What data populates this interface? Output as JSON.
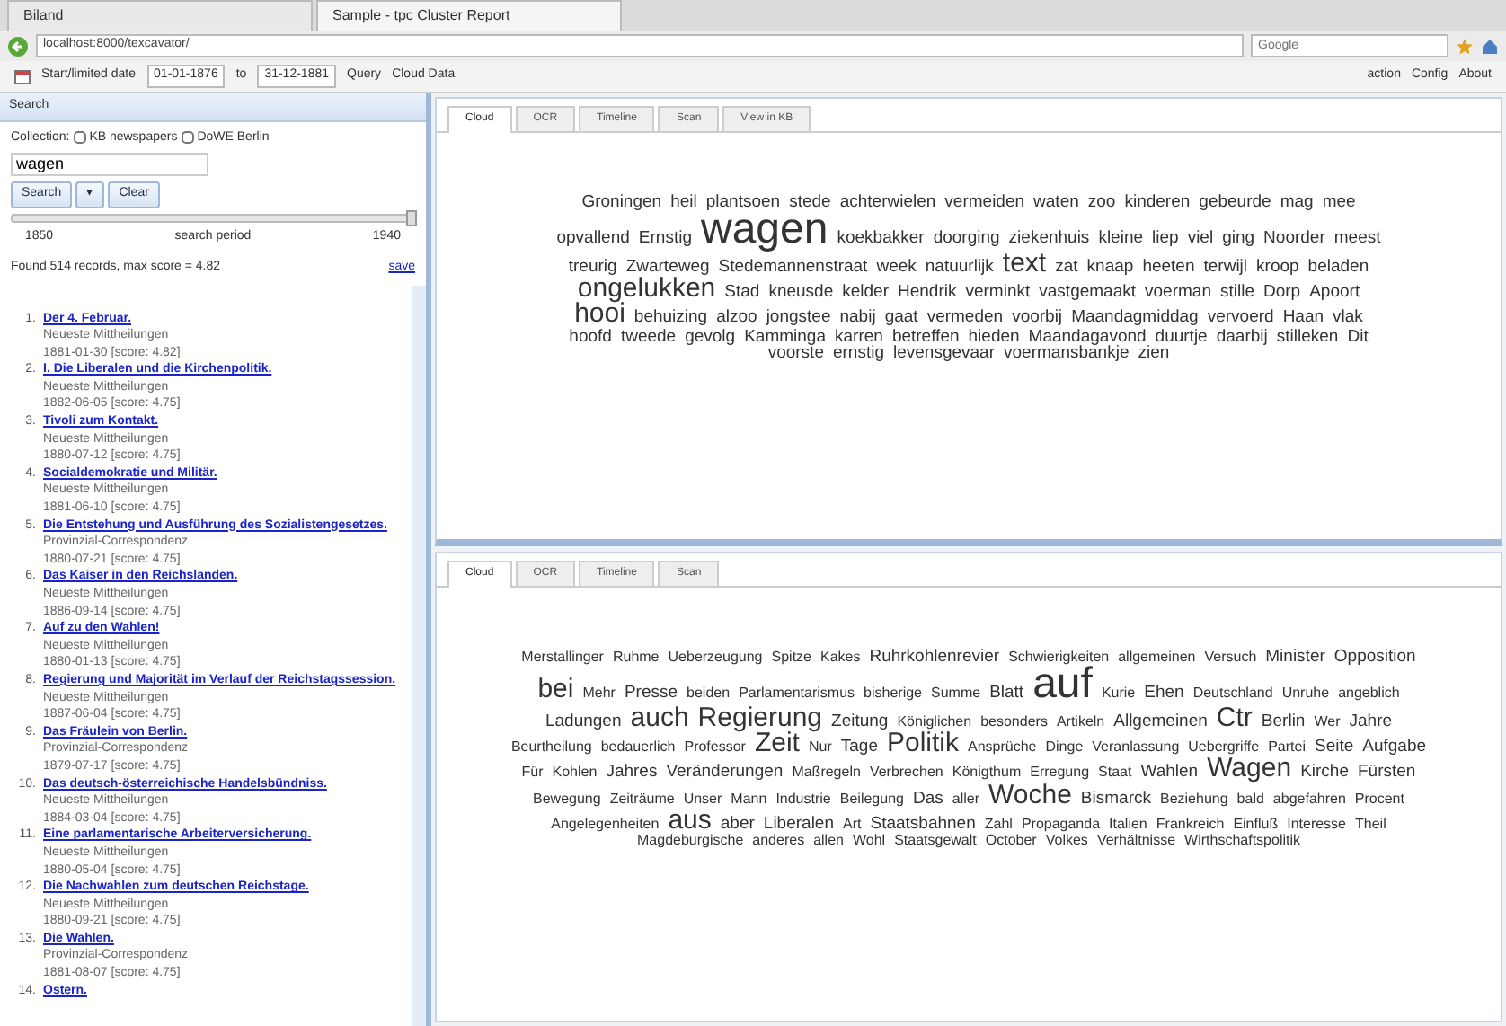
{
  "browser": {
    "tabs": [
      {
        "label": "Biland",
        "selected": false
      },
      {
        "label": "Sample - tpc Cluster Report",
        "selected": true
      }
    ],
    "address": "localhost:8000/texcavator/",
    "search_placeholder": "Google"
  },
  "toolbar": {
    "date_label": "Start/limited date",
    "start_date": "01-01-1876",
    "to": "to",
    "end_date": "31-12-1881",
    "buttons": [
      "Query",
      "Cloud Data"
    ],
    "right": [
      "action",
      "Config",
      "About"
    ]
  },
  "search": {
    "title": "Search",
    "collection_label": "Collection:",
    "collections": [
      {
        "label": "KB newspapers",
        "checked": false
      },
      {
        "label": "DoWE Berlin",
        "checked": false
      }
    ],
    "query": "wagen",
    "search_button": "Search",
    "dropdown_caret": "▾",
    "clear_button": "Clear",
    "range": {
      "level": 1
    },
    "range_start": "1850",
    "range_label": "search period",
    "range_end": "1940",
    "found": "Found 514 records, max score = 4.82",
    "save": "save"
  },
  "results": [
    {
      "number": "1.",
      "title": "Der 4. Februar.",
      "source": "Neueste Mittheilungen",
      "date": "1881-01-30 [score: 4.82]"
    },
    {
      "number": "2.",
      "title": "I. Die Liberalen und die Kirchenpolitik.",
      "source": "Neueste Mittheilungen",
      "date": "1882-06-05 [score: 4.75]"
    },
    {
      "number": "3.",
      "title": "Tivoli zum Kontakt.",
      "source": "Neueste Mittheilungen",
      "date": "1880-07-12 [score: 4.75]"
    },
    {
      "number": "4.",
      "title": "Socialdemokratie und Militär.",
      "source": "Neueste Mittheilungen",
      "date": "1881-06-10 [score: 4.75]"
    },
    {
      "number": "5.",
      "title": "Die Entstehung und Ausführung des Sozialistengesetzes.",
      "source": "Provinzial-Correspondenz",
      "date": "1880-07-21 [score: 4.75]"
    },
    {
      "number": "6.",
      "title": "Das Kaiser in den Reichslanden.",
      "source": "Neueste Mittheilungen",
      "date": "1886-09-14 [score: 4.75]"
    },
    {
      "number": "7.",
      "title": "Auf zu den Wahlen!",
      "source": "Neueste Mittheilungen",
      "date": "1880-01-13 [score: 4.75]"
    },
    {
      "number": "8.",
      "title": "Regierung und Majorität im Verlauf der Reichstagssession.",
      "source": "Neueste Mittheilungen",
      "date": "1887-06-04 [score: 4.75]"
    },
    {
      "number": "9.",
      "title": "Das Fräulein von Berlin.",
      "source": "Provinzial-Correspondenz",
      "date": "1879-07-17 [score: 4.75]"
    },
    {
      "number": "10.",
      "title": "Das deutsch-österreichische Handelsbündniss.",
      "source": "Neueste Mittheilungen",
      "date": "1884-03-04 [score: 4.75]"
    },
    {
      "number": "11.",
      "title": "Eine parlamentarische Arbeiterversicherung.",
      "source": "Neueste Mittheilungen",
      "date": "1880-05-04 [score: 4.75]"
    },
    {
      "number": "12.",
      "title": "Die Nachwahlen zum deutschen Reichstage.",
      "source": "Neueste Mittheilungen",
      "date": "1880-09-21 [score: 4.75]"
    },
    {
      "number": "13.",
      "title": "Die Wahlen.",
      "source": "Provinzial-Correspondenz",
      "date": "1881-08-07 [score: 4.75]"
    },
    {
      "number": "14.",
      "title": "Ostern."
    }
  ],
  "panels": [
    {
      "tabs": [
        {
          "label": "Cloud",
          "selected": true
        },
        {
          "label": "OCR",
          "selected": false
        },
        {
          "label": "Timeline",
          "selected": false
        },
        {
          "label": "Scan",
          "selected": false
        },
        {
          "label": "View in KB",
          "selected": false
        }
      ],
      "words": [
        {
          "text": "Groningen",
          "kind": "medium"
        },
        {
          "text": "heil",
          "kind": "medium"
        },
        {
          "text": "plantsoen",
          "kind": "medium"
        },
        {
          "text": "stede",
          "kind": "medium"
        },
        {
          "text": "achterwielen",
          "kind": "medium"
        },
        {
          "text": "vermeiden",
          "kind": "medium"
        },
        {
          "text": "waten",
          "kind": "medium"
        },
        {
          "text": "zoo",
          "kind": "medium"
        },
        {
          "text": "kinderen",
          "kind": "medium"
        },
        {
          "text": "gebeurde",
          "kind": "medium"
        },
        {
          "text": "mag",
          "kind": "medium"
        },
        {
          "text": "mee",
          "kind": "medium"
        },
        {
          "text": "opvallend",
          "kind": "medium"
        },
        {
          "text": "Ernstig",
          "kind": "medium"
        },
        {
          "text": "wagen",
          "kind": "huge"
        },
        {
          "text": "koekbakker",
          "kind": "medium"
        },
        {
          "text": "doorging",
          "kind": "medium"
        },
        {
          "text": "ziekenhuis",
          "kind": "medium"
        },
        {
          "text": "kleine",
          "kind": "medium"
        },
        {
          "text": "liep",
          "kind": "medium"
        },
        {
          "text": "viel",
          "kind": "medium"
        },
        {
          "text": "ging",
          "kind": "medium"
        },
        {
          "text": "Noorder",
          "kind": "medium"
        },
        {
          "text": "meest",
          "kind": "medium"
        },
        {
          "text": "treurig",
          "kind": "medium"
        },
        {
          "text": "Zwarteweg",
          "kind": "medium"
        },
        {
          "text": "Stedemannenstraat",
          "kind": "medium"
        },
        {
          "text": "week",
          "kind": "medium"
        },
        {
          "text": "natuurlijk",
          "kind": "medium"
        },
        {
          "text": "text",
          "kind": "large"
        },
        {
          "text": "zat",
          "kind": "medium"
        },
        {
          "text": "knaap",
          "kind": "medium"
        },
        {
          "text": "heeten",
          "kind": "medium"
        },
        {
          "text": "terwijl",
          "kind": "medium"
        },
        {
          "text": "kroop",
          "kind": "medium"
        },
        {
          "text": "beladen",
          "kind": "medium"
        },
        {
          "text": "ongelukken",
          "kind": "large"
        },
        {
          "text": "Stad",
          "kind": "medium"
        },
        {
          "text": "kneusde",
          "kind": "medium"
        },
        {
          "text": "kelder",
          "kind": "medium"
        },
        {
          "text": "Hendrik",
          "kind": "medium"
        },
        {
          "text": "verminkt",
          "kind": "medium"
        },
        {
          "text": "vastgemaakt",
          "kind": "medium"
        },
        {
          "text": "voerman",
          "kind": "medium"
        },
        {
          "text": "stille",
          "kind": "medium"
        },
        {
          "text": "Dorp",
          "kind": "medium"
        },
        {
          "text": "Apoort",
          "kind": "medium"
        },
        {
          "text": "hooi",
          "kind": "large"
        },
        {
          "text": "behuizing",
          "kind": "medium"
        },
        {
          "text": "alzoo",
          "kind": "medium"
        },
        {
          "text": "jongstee",
          "kind": "medium"
        },
        {
          "text": "nabij",
          "kind": "medium"
        },
        {
          "text": "gaat",
          "kind": "medium"
        },
        {
          "text": "vermeden",
          "kind": "medium"
        },
        {
          "text": "voorbij",
          "kind": "medium"
        },
        {
          "text": "Maandagmiddag",
          "kind": "medium"
        },
        {
          "text": "vervoerd",
          "kind": "medium"
        },
        {
          "text": "Haan",
          "kind": "medium"
        },
        {
          "text": "vlak",
          "kind": "medium"
        },
        {
          "text": "hoofd",
          "kind": "medium"
        },
        {
          "text": "tweede",
          "kind": "medium"
        },
        {
          "text": "gevolg",
          "kind": "medium"
        },
        {
          "text": "Kamminga",
          "kind": "medium"
        },
        {
          "text": "karren",
          "kind": "medium"
        },
        {
          "text": "betreffen",
          "kind": "medium"
        },
        {
          "text": "hieden",
          "kind": "medium"
        },
        {
          "text": "Maandagavond",
          "kind": "medium"
        },
        {
          "text": "duurtje",
          "kind": "medium"
        },
        {
          "text": "daarbij",
          "kind": "medium"
        },
        {
          "text": "stilleken",
          "kind": "medium"
        },
        {
          "text": "Dit",
          "kind": "medium"
        },
        {
          "text": "voorste",
          "kind": "medium"
        },
        {
          "text": "ernstig",
          "kind": "medium"
        },
        {
          "text": "levensgevaar",
          "kind": "medium"
        },
        {
          "text": "voermansbankje",
          "kind": "medium"
        },
        {
          "text": "zien",
          "kind": "medium"
        }
      ]
    },
    {
      "tabs": [
        {
          "label": "Cloud",
          "selected": true
        },
        {
          "label": "OCR",
          "selected": false
        },
        {
          "label": "Timeline",
          "selected": false
        },
        {
          "label": "Scan",
          "selected": false
        }
      ],
      "words": [
        {
          "text": "Merstallinger",
          "kind": "small"
        },
        {
          "text": "Ruhme",
          "kind": "small"
        },
        {
          "text": "Ueberzeugung",
          "kind": "small"
        },
        {
          "text": "Spitze",
          "kind": "small"
        },
        {
          "text": "Kakes",
          "kind": "small"
        },
        {
          "text": "Ruhrkohlenrevier",
          "kind": "medium"
        },
        {
          "text": "Schwierigkeiten",
          "kind": "small"
        },
        {
          "text": "allgemeinen",
          "kind": "small"
        },
        {
          "text": "Versuch",
          "kind": "small"
        },
        {
          "text": "Minister",
          "kind": "medium"
        },
        {
          "text": "Opposition",
          "kind": "medium"
        },
        {
          "text": "bei",
          "kind": "large"
        },
        {
          "text": "Mehr",
          "kind": "small"
        },
        {
          "text": "Presse",
          "kind": "medium"
        },
        {
          "text": "beiden",
          "kind": "small"
        },
        {
          "text": "Parlamentarismus",
          "kind": "small"
        },
        {
          "text": "bisherige",
          "kind": "small"
        },
        {
          "text": "Summe",
          "kind": "small"
        },
        {
          "text": "Blatt",
          "kind": "medium"
        },
        {
          "text": "auf",
          "kind": "huge"
        },
        {
          "text": "Kurie",
          "kind": "small"
        },
        {
          "text": "Ehen",
          "kind": "medium"
        },
        {
          "text": "Deutschland",
          "kind": "small"
        },
        {
          "text": "Unruhe",
          "kind": "small"
        },
        {
          "text": "angeblich",
          "kind": "small"
        },
        {
          "text": "Ladungen",
          "kind": "medium"
        },
        {
          "text": "auch",
          "kind": "large"
        },
        {
          "text": "Regierung",
          "kind": "large"
        },
        {
          "text": "Zeitung",
          "kind": "medium"
        },
        {
          "text": "Königlichen",
          "kind": "small"
        },
        {
          "text": "besonders",
          "kind": "small"
        },
        {
          "text": "Artikeln",
          "kind": "small"
        },
        {
          "text": "Allgemeinen",
          "kind": "medium"
        },
        {
          "text": "Ctr",
          "kind": "large"
        },
        {
          "text": "Berlin",
          "kind": "medium"
        },
        {
          "text": "Wer",
          "kind": "small"
        },
        {
          "text": "Jahre",
          "kind": "medium"
        },
        {
          "text": "Beurtheilung",
          "kind": "small"
        },
        {
          "text": "bedauerlich",
          "kind": "small"
        },
        {
          "text": "Professor",
          "kind": "small"
        },
        {
          "text": "Zeit",
          "kind": "large"
        },
        {
          "text": "Nur",
          "kind": "small"
        },
        {
          "text": "Tage",
          "kind": "medium"
        },
        {
          "text": "Politik",
          "kind": "large"
        },
        {
          "text": "Ansprüche",
          "kind": "small"
        },
        {
          "text": "Dinge",
          "kind": "small"
        },
        {
          "text": "Veranlassung",
          "kind": "small"
        },
        {
          "text": "Uebergriffe",
          "kind": "small"
        },
        {
          "text": "Partei",
          "kind": "small"
        },
        {
          "text": "Seite",
          "kind": "medium"
        },
        {
          "text": "Aufgabe",
          "kind": "medium"
        },
        {
          "text": "Für",
          "kind": "small"
        },
        {
          "text": "Kohlen",
          "kind": "small"
        },
        {
          "text": "Jahres",
          "kind": "medium"
        },
        {
          "text": "Veränderungen",
          "kind": "medium"
        },
        {
          "text": "Maßregeln",
          "kind": "small"
        },
        {
          "text": "Verbrechen",
          "kind": "small"
        },
        {
          "text": "Königthum",
          "kind": "small"
        },
        {
          "text": "Erregung",
          "kind": "small"
        },
        {
          "text": "Staat",
          "kind": "small"
        },
        {
          "text": "Wahlen",
          "kind": "medium"
        },
        {
          "text": "Wagen",
          "kind": "large"
        },
        {
          "text": "Kirche",
          "kind": "medium"
        },
        {
          "text": "Fürsten",
          "kind": "medium"
        },
        {
          "text": "Bewegung",
          "kind": "small"
        },
        {
          "text": "Zeiträume",
          "kind": "small"
        },
        {
          "text": "Unser",
          "kind": "small"
        },
        {
          "text": "Mann",
          "kind": "small"
        },
        {
          "text": "Industrie",
          "kind": "small"
        },
        {
          "text": "Beilegung",
          "kind": "small"
        },
        {
          "text": "Das",
          "kind": "medium"
        },
        {
          "text": "aller",
          "kind": "small"
        },
        {
          "text": "Woche",
          "kind": "large"
        },
        {
          "text": "Bismarck",
          "kind": "medium"
        },
        {
          "text": "Beziehung",
          "kind": "small"
        },
        {
          "text": "bald",
          "kind": "small"
        },
        {
          "text": "abgefahren",
          "kind": "small"
        },
        {
          "text": "Procent",
          "kind": "small"
        },
        {
          "text": "Angelegenheiten",
          "kind": "small"
        },
        {
          "text": "aus",
          "kind": "large"
        },
        {
          "text": "aber",
          "kind": "medium"
        },
        {
          "text": "Liberalen",
          "kind": "medium"
        },
        {
          "text": "Art",
          "kind": "small"
        },
        {
          "text": "Staatsbahnen",
          "kind": "medium"
        },
        {
          "text": "Zahl",
          "kind": "small"
        },
        {
          "text": "Propaganda",
          "kind": "small"
        },
        {
          "text": "Italien",
          "kind": "small"
        },
        {
          "text": "Frankreich",
          "kind": "small"
        },
        {
          "text": "Einfluß",
          "kind": "small"
        },
        {
          "text": "Interesse",
          "kind": "small"
        },
        {
          "text": "Theil",
          "kind": "small"
        },
        {
          "text": "Magdeburgische",
          "kind": "small"
        },
        {
          "text": "anderes",
          "kind": "small"
        },
        {
          "text": "allen",
          "kind": "small"
        },
        {
          "text": "Wohl",
          "kind": "small"
        },
        {
          "text": "Staatsgewalt",
          "kind": "small"
        },
        {
          "text": "October",
          "kind": "small"
        },
        {
          "text": "Volkes",
          "kind": "small"
        },
        {
          "text": "Verhältnisse",
          "kind": "small"
        },
        {
          "text": "Wirthschaftspolitik",
          "kind": "small"
        }
      ]
    }
  ]
}
